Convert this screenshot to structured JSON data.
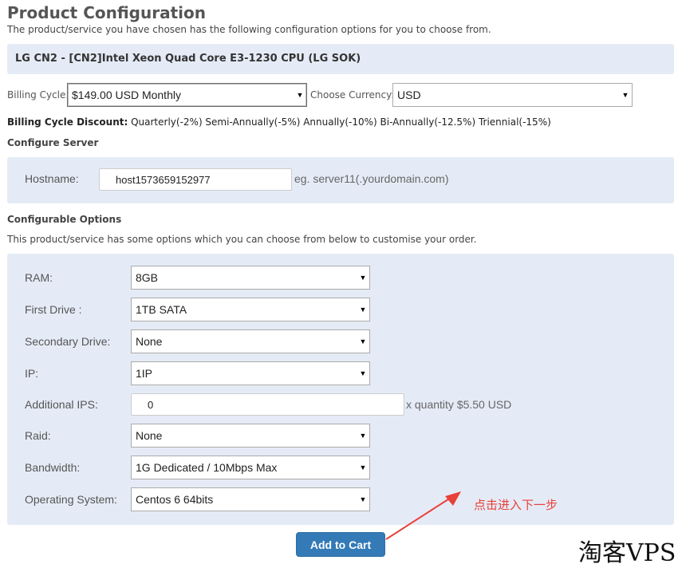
{
  "header": {
    "title": "Product Configuration",
    "subtitle": "The product/service you have chosen has the following configuration options for you to choose from."
  },
  "product": {
    "name": "LG CN2 - [CN2]Intel Xeon Quad Core E3-1230 CPU (LG SOK)"
  },
  "billing": {
    "cycle_label": "Billing Cycle:",
    "cycle_value": "$149.00 USD Monthly",
    "currency_label": "Choose Currency:",
    "currency_value": "USD",
    "discount_label": "Billing Cycle Discount:",
    "discount_text": " Quarterly(-2%) Semi-Annually(-5%) Annually(-10%) Bi-Annually(-12.5%) Triennial(-15%)"
  },
  "server": {
    "section_title": "Configure Server",
    "hostname_label": "Hostname:",
    "hostname_value": "host1573659152977",
    "hostname_hint": "eg. server11(.yourdomain.com)"
  },
  "options": {
    "section_title": "Configurable Options",
    "description": "This product/service has some options which you can choose from below to customise your order.",
    "ram": {
      "label": "RAM:",
      "value": "8GB"
    },
    "first_drive": {
      "label": "First Drive :",
      "value": "1TB SATA"
    },
    "secondary_drive": {
      "label": "Secondary Drive:",
      "value": "None"
    },
    "ip": {
      "label": "IP:",
      "value": "1IP"
    },
    "additional_ips": {
      "label": "Additional IPS:",
      "value": "0",
      "hint": "x quantity $5.50 USD"
    },
    "raid": {
      "label": "Raid:",
      "value": "None"
    },
    "bandwidth": {
      "label": "Bandwidth:",
      "value": "1G Dedicated / 10Mbps Max"
    },
    "os": {
      "label": "Operating System:",
      "value": "Centos 6 64bits"
    }
  },
  "actions": {
    "add_to_cart": "Add to Cart"
  },
  "annotation": {
    "note": "点击进入下一步",
    "color": "#e8413a"
  },
  "watermark": "淘客VPS",
  "icons": {
    "dropdown": "chevron-down-icon",
    "arrow": "red-arrow-icon"
  }
}
